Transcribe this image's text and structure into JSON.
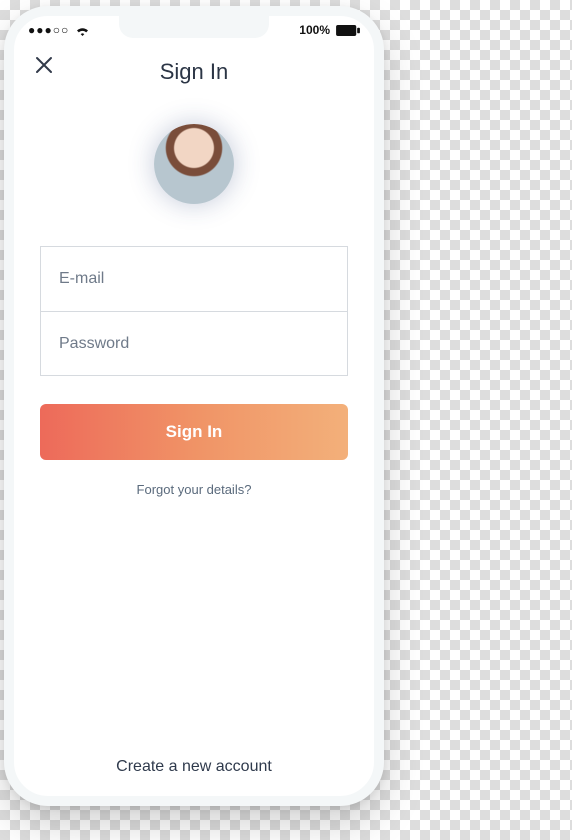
{
  "status": {
    "battery_text": "100%",
    "signal_icon": "signal-dots-icon",
    "wifi_icon": "wifi-icon",
    "battery_icon": "battery-icon"
  },
  "header": {
    "close_icon": "close-icon",
    "title": "Sign In"
  },
  "avatar": {
    "name": "user-avatar"
  },
  "form": {
    "email_placeholder": "E-mail",
    "password_placeholder": "Password",
    "submit_label": "Sign In",
    "forgot_label": "Forgot your details?"
  },
  "footer": {
    "create_label": "Create a new account"
  }
}
